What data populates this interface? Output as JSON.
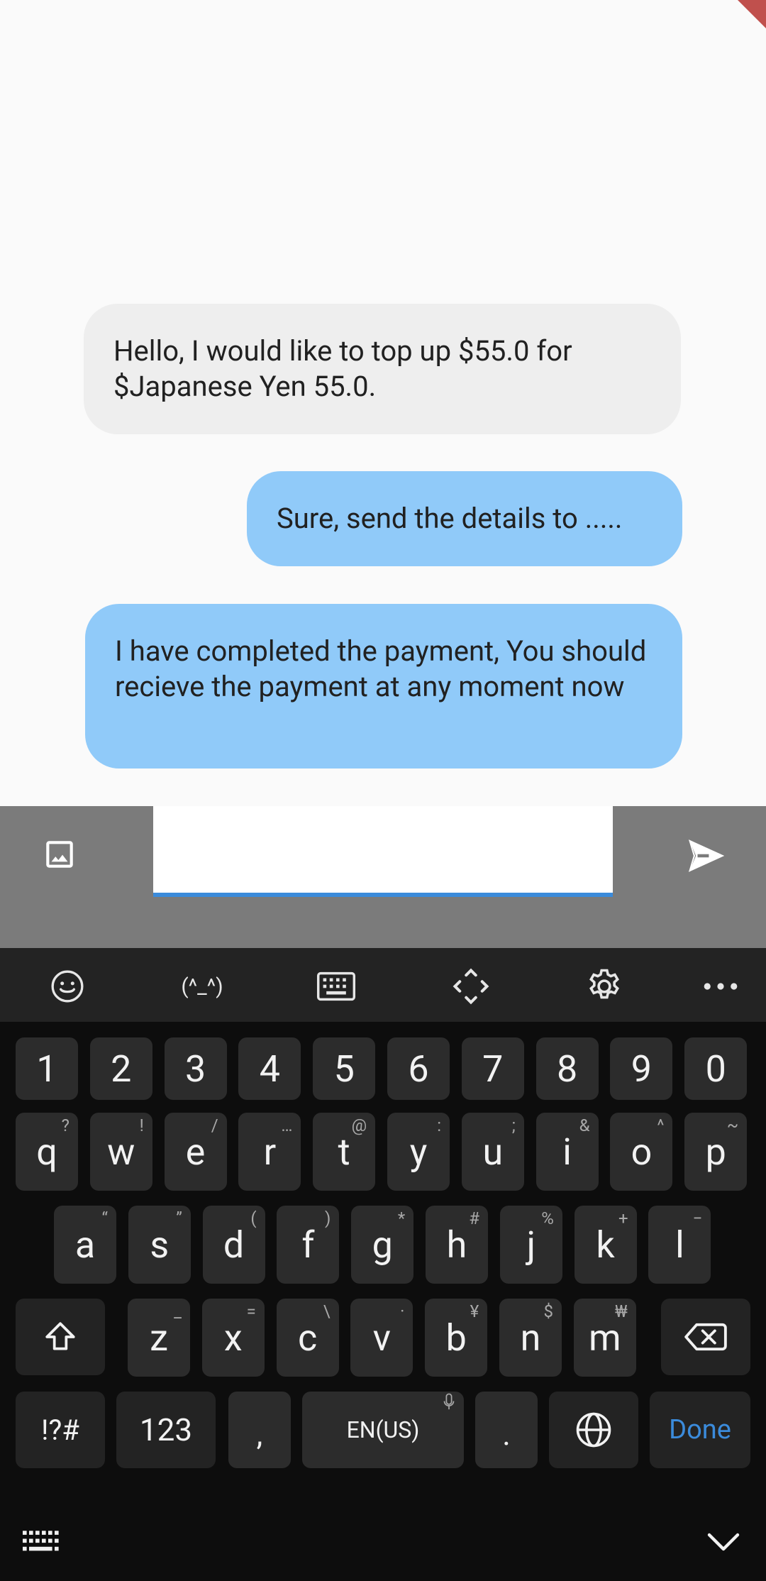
{
  "messages": [
    {
      "text": "Hello, I would like to top up $55.0 for $Japanese Yen 55.0."
    },
    {
      "text": "Sure, send the details to ....."
    },
    {
      "text": "I have completed the payment, You should recieve the payment at any moment now"
    }
  ],
  "composer": {
    "input_value": "",
    "image_icon": "image-icon",
    "send_icon": "send-icon"
  },
  "keyboard": {
    "toolbar": [
      {
        "name": "emoji-icon"
      },
      {
        "name": "kaomoji",
        "label": "(^_^)"
      },
      {
        "name": "keyboard-icon"
      },
      {
        "name": "cursor-move-icon"
      },
      {
        "name": "settings-icon"
      },
      {
        "name": "more-icon"
      }
    ],
    "numbers": [
      "1",
      "2",
      "3",
      "4",
      "5",
      "6",
      "7",
      "8",
      "9",
      "0"
    ],
    "row1": [
      {
        "k": "q",
        "h": "?"
      },
      {
        "k": "w",
        "h": "!"
      },
      {
        "k": "e",
        "h": "/"
      },
      {
        "k": "r",
        "h": "…"
      },
      {
        "k": "t",
        "h": "@"
      },
      {
        "k": "y",
        "h": ":"
      },
      {
        "k": "u",
        "h": ";"
      },
      {
        "k": "i",
        "h": "&"
      },
      {
        "k": "o",
        "h": "^"
      },
      {
        "k": "p",
        "h": "~"
      }
    ],
    "row2": [
      {
        "k": "a",
        "h": "“"
      },
      {
        "k": "s",
        "h": "”"
      },
      {
        "k": "d",
        "h": "("
      },
      {
        "k": "f",
        "h": ")"
      },
      {
        "k": "g",
        "h": "*"
      },
      {
        "k": "h",
        "h": "#"
      },
      {
        "k": "j",
        "h": "%"
      },
      {
        "k": "k",
        "h": "+"
      },
      {
        "k": "l",
        "h": "−"
      }
    ],
    "row3": [
      {
        "k": "z",
        "h": "_"
      },
      {
        "k": "x",
        "h": "="
      },
      {
        "k": "c",
        "h": "\\"
      },
      {
        "k": "v",
        "h": "·"
      },
      {
        "k": "b",
        "h": "¥"
      },
      {
        "k": "n",
        "h": "$"
      },
      {
        "k": "m",
        "h": "₩"
      }
    ],
    "symbols_label": "!?#",
    "num_label": "123",
    "comma": ",",
    "space_label": "EN(US)",
    "period": ".",
    "done_label": "Done"
  }
}
